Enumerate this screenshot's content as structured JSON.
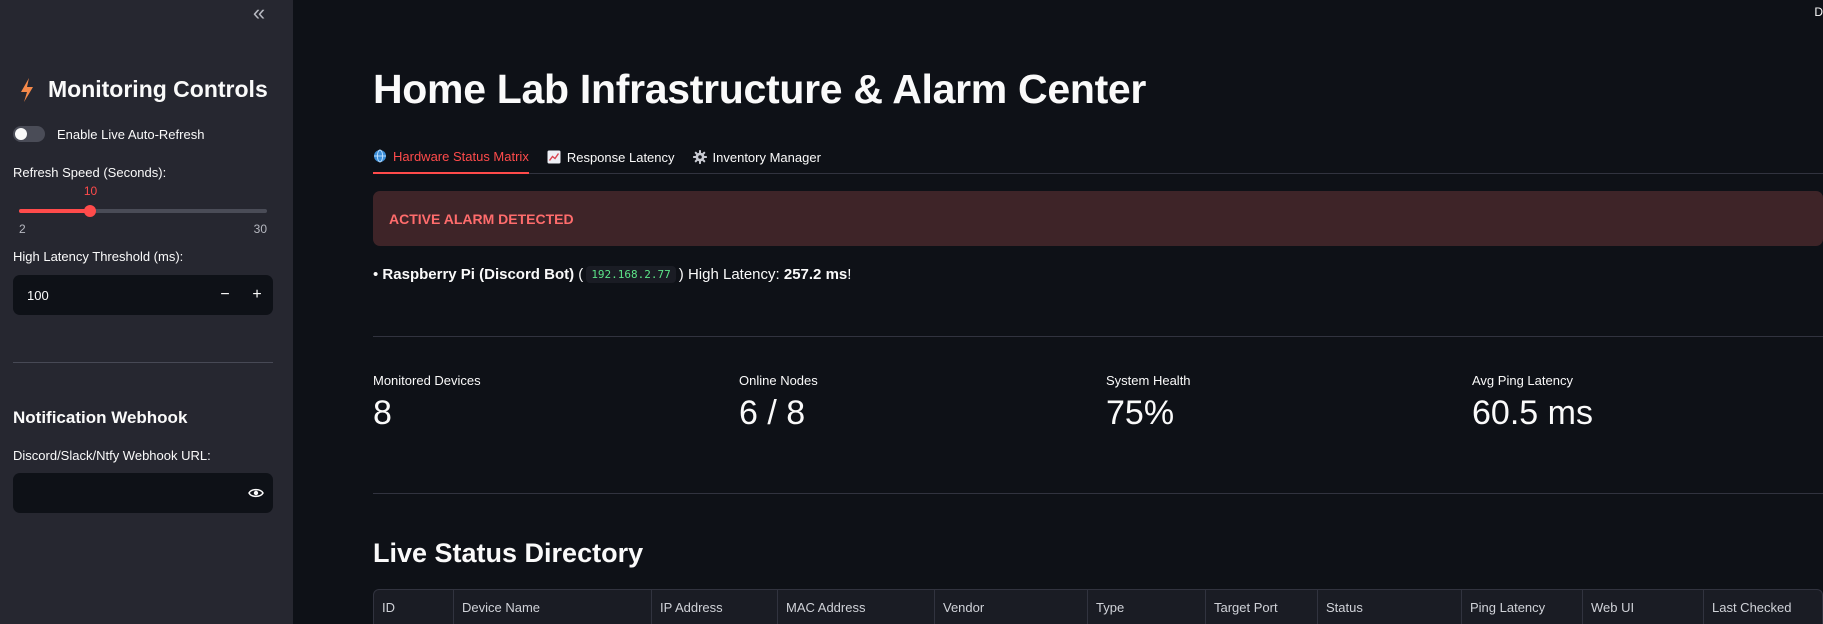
{
  "sidebar": {
    "collapse_glyph": "«",
    "title": "Monitoring Controls",
    "auto_refresh_label": "Enable Live Auto-Refresh",
    "auto_refresh_enabled": false,
    "refresh_label": "Refresh Speed (Seconds):",
    "refresh_value": "10",
    "refresh_min": "2",
    "refresh_max": "30",
    "threshold_label": "High Latency Threshold (ms):",
    "threshold_value": "100",
    "minus_glyph": "−",
    "plus_glyph": "+",
    "webhook_title": "Notification Webhook",
    "webhook_label": "Discord/Slack/Ntfy Webhook URL:",
    "webhook_value": "",
    "accent_color": "#ff4b4b"
  },
  "header": {
    "corner_text": "D",
    "title": "Home Lab Infrastructure & Alarm Center"
  },
  "tabs": [
    {
      "label": "Hardware Status Matrix",
      "icon": "globe-icon",
      "active": true
    },
    {
      "label": "Response Latency",
      "icon": "chart-icon",
      "active": false
    },
    {
      "label": "Inventory Manager",
      "icon": "gear-icon",
      "active": false
    }
  ],
  "alarm": {
    "banner": "ACTIVE ALARM DETECTED",
    "bullet": "• ",
    "device": "Raspberry Pi (Discord Bot)",
    "open_paren": " (",
    "ip": "192.168.2.77",
    "close_text": ") High Latency: ",
    "latency": "257.2 ms",
    "suffix": "!"
  },
  "metrics": [
    {
      "label": "Monitored Devices",
      "value": "8"
    },
    {
      "label": "Online Nodes",
      "value": "6 / 8"
    },
    {
      "label": "System Health",
      "value": "75%"
    },
    {
      "label": "Avg Ping Latency",
      "value": "60.5 ms"
    }
  ],
  "directory": {
    "title": "Live Status Directory",
    "columns": [
      "ID",
      "Device Name",
      "IP Address",
      "MAC Address",
      "Vendor",
      "Type",
      "Target Port",
      "Status",
      "Ping Latency",
      "Web UI",
      "Last Checked"
    ]
  }
}
